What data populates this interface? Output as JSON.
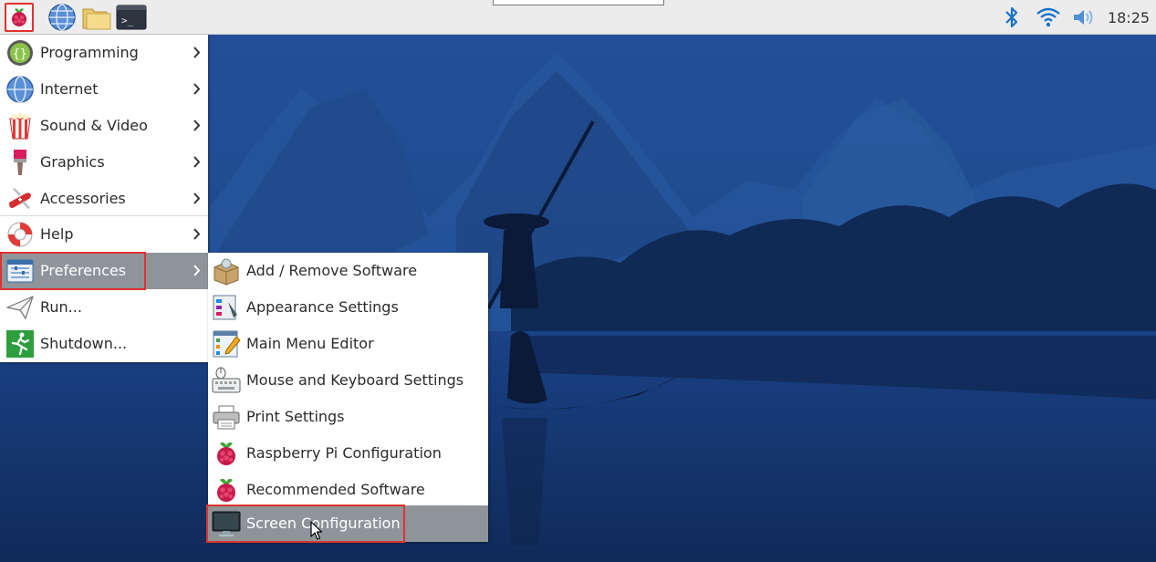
{
  "taskbar": {
    "clock": "18:25",
    "launchers": [
      "raspberry-menu-icon",
      "web-browser-icon",
      "file-manager-icon",
      "terminal-icon"
    ],
    "tray": [
      "bluetooth-icon",
      "wifi-icon",
      "volume-icon"
    ]
  },
  "main_menu": {
    "items": [
      {
        "label": "Programming",
        "icon": "programming-icon",
        "has_submenu": true
      },
      {
        "label": "Internet",
        "icon": "internet-globe-icon",
        "has_submenu": true
      },
      {
        "label": "Sound & Video",
        "icon": "popcorn-icon",
        "has_submenu": true
      },
      {
        "label": "Graphics",
        "icon": "paintbrush-icon",
        "has_submenu": true
      },
      {
        "label": "Accessories",
        "icon": "swiss-knife-icon",
        "has_submenu": true
      },
      {
        "label": "Help",
        "icon": "lifebuoy-icon",
        "has_submenu": true
      },
      {
        "label": "Preferences",
        "icon": "preferences-icon",
        "has_submenu": true,
        "highlighted": true
      },
      {
        "label": "Run...",
        "icon": "paper-plane-icon",
        "has_submenu": false
      },
      {
        "label": "Shutdown...",
        "icon": "exit-running-icon",
        "has_submenu": false
      }
    ]
  },
  "preferences_submenu": {
    "items": [
      {
        "label": "Add / Remove Software",
        "icon": "package-icon"
      },
      {
        "label": "Appearance Settings",
        "icon": "appearance-icon"
      },
      {
        "label": "Main Menu Editor",
        "icon": "menu-editor-icon"
      },
      {
        "label": "Mouse and Keyboard Settings",
        "icon": "keyboard-mouse-icon"
      },
      {
        "label": "Print Settings",
        "icon": "printer-icon"
      },
      {
        "label": "Raspberry Pi Configuration",
        "icon": "raspberry-icon"
      },
      {
        "label": "Recommended Software",
        "icon": "raspberry-icon"
      },
      {
        "label": "Screen Configuration",
        "icon": "monitor-icon",
        "highlighted": true
      }
    ]
  },
  "colors": {
    "highlight": "#8e949a",
    "annotation_outline": "#e0322f",
    "taskbar": "#ececec",
    "tray_icon": "#1a73c7"
  }
}
